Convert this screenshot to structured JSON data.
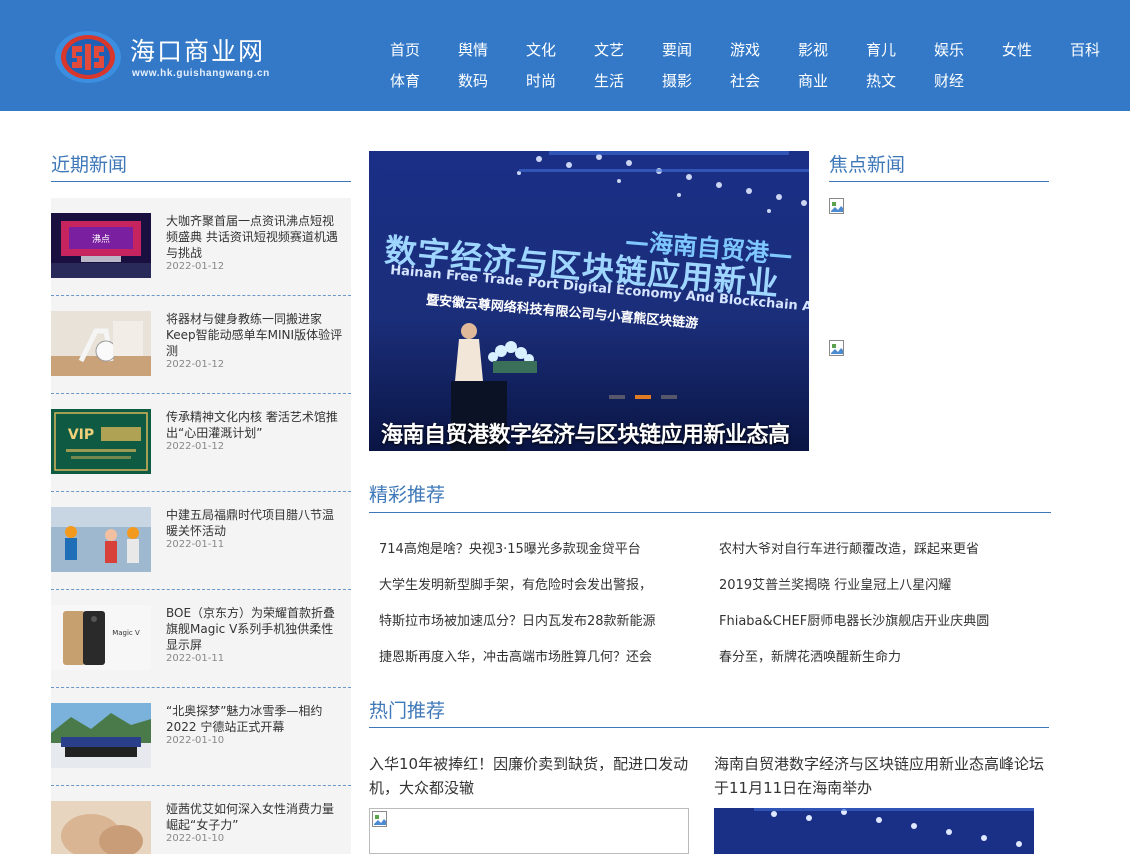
{
  "header": {
    "logo_title": "海口商业网",
    "logo_url": "www.hk.guishangwang.cn",
    "nav_row1": [
      "首页",
      "舆情",
      "文化",
      "文艺",
      "要闻",
      "游戏",
      "影视",
      "育儿",
      "娱乐",
      "女性",
      "百科"
    ],
    "nav_row2": [
      "体育",
      "数码",
      "时尚",
      "生活",
      "摄影",
      "社会",
      "商业",
      "热文",
      "财经"
    ]
  },
  "recent": {
    "heading": "近期新闻",
    "items": [
      {
        "title": "大咖齐聚首届一点资讯沸点短视频盛典 共话资讯短视频赛道机遇与挑战",
        "date": "2022-01-12"
      },
      {
        "title": "将器材与健身教练一同搬进家 Keep智能动感单车MINI版体验评测",
        "date": "2022-01-12"
      },
      {
        "title": "传承精神文化内核 奢活艺术馆推出“心田灌溉计划”",
        "date": "2022-01-12"
      },
      {
        "title": "中建五局福鼎时代项目腊八节温暖关怀活动",
        "date": "2022-01-11"
      },
      {
        "title": "BOE（京东方）为荣耀首款折叠旗舰Magic V系列手机独供柔性显示屏",
        "date": "2022-01-11"
      },
      {
        "title": "“北奥探梦”魅力冰雪季—相约2022 宁德站正式开幕",
        "date": "2022-01-10"
      },
      {
        "title": "娅茜优艾如何深入女性消费力量 崛起“女子力”",
        "date": "2022-01-10"
      }
    ]
  },
  "slider": {
    "caption": "海南自贸港数字经济与区块链应用新业态高",
    "banner_cn": "数字经济与区块链应用新业",
    "banner_en": "Hainan Free Trade Port Digital Economy And Blockchain Applicati",
    "banner_tag": "—海南自贸港—",
    "banner_sub": "暨安徽云尊网络科技有限公司与小喜熊区块链游",
    "active_dot": 1
  },
  "focus": {
    "heading": "焦点新闻"
  },
  "recommend": {
    "heading": "精彩推荐",
    "left": [
      "714高炮是啥？央视3·15曝光多款现金贷平台",
      "大学生发明新型脚手架，有危险时会发出警报，",
      "特斯拉市场被加速瓜分？日内瓦发布28款新能源",
      "捷恩斯再度入华，冲击高端市场胜算几何？还会"
    ],
    "right": [
      "农村大爷对自行车进行颠覆改造，踩起来更省",
      "2019艾普兰奖揭晓 行业皇冠上八星闪耀",
      "Fhiaba&CHEF厨师电器长沙旗舰店开业庆典圆",
      "春分至，新牌花洒唤醒新生命力"
    ]
  },
  "hot": {
    "heading": "热门推荐",
    "items": [
      {
        "title": "入华10年被捧红！因廉价卖到缺货，配进口发动机，大众都没辙"
      },
      {
        "title": "海南自贸港数字经济与区块链应用新业态高峰论坛于11月11日在海南举办"
      }
    ]
  },
  "colors": {
    "header_bg": "#3379c8",
    "accent": "#3f78b8",
    "slider_active_dot": "#e07b25"
  }
}
